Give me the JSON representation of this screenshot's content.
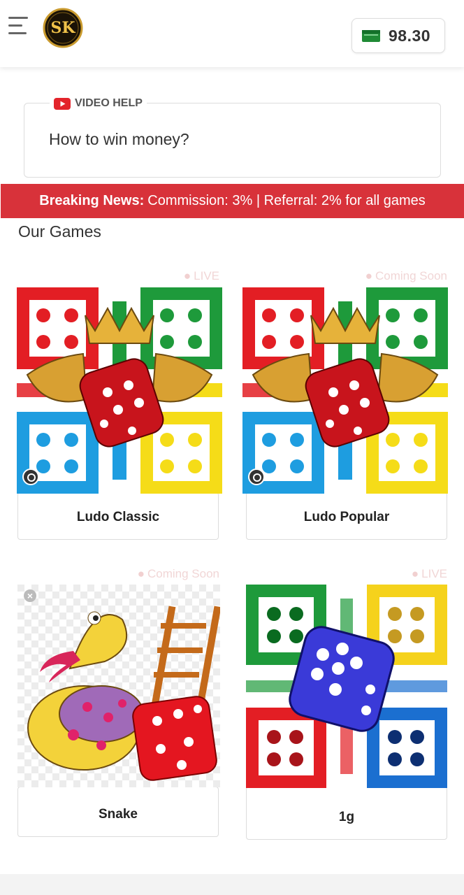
{
  "header": {
    "menu_icon": "hamburger-menu-icon",
    "logo_text": "SK",
    "wallet_icon": "wallet-icon",
    "wallet_amount": "98.30"
  },
  "video_help": {
    "icon": "youtube-play-icon",
    "label": "VIDEO HELP",
    "question": "How to win money?"
  },
  "news": {
    "prefix": "Breaking News:",
    "text": "Commission: 3% | Referral: 2% for all games",
    "color": "#d8323a"
  },
  "games_section": {
    "title": "Our Games",
    "games": [
      {
        "name": "Ludo Classic",
        "status": "LIVE"
      },
      {
        "name": "Ludo Popular",
        "status": "Coming Soon"
      },
      {
        "name": "Snake",
        "status": "Coming Soon"
      },
      {
        "name": "1g",
        "status": "LIVE"
      }
    ]
  }
}
